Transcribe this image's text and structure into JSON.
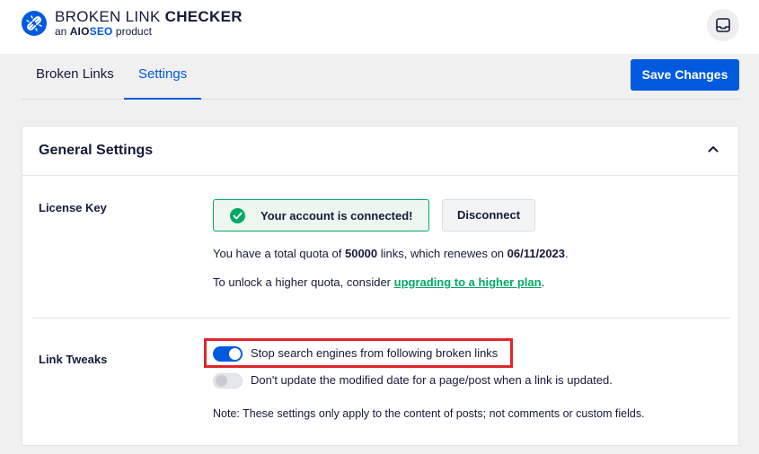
{
  "header": {
    "brand_part1": "BROKEN LINK ",
    "brand_part2": "CHECKER",
    "tagline_prefix": "an ",
    "tagline_aio": "AIO",
    "tagline_seo": "SEO",
    "tagline_suffix": " product",
    "logo_icon": "broken-link-logo-icon",
    "inbox_icon": "inbox-icon"
  },
  "tabs": [
    {
      "label": "Broken Links",
      "active": false
    },
    {
      "label": "Settings",
      "active": true
    }
  ],
  "toolbar": {
    "save_label": "Save Changes"
  },
  "general": {
    "title": "General Settings",
    "collapse_icon": "chevron-up-icon",
    "license": {
      "label": "License Key",
      "status_text": "Your account is connected!",
      "disconnect_label": "Disconnect",
      "quota_prefix": "You have a total quota of ",
      "quota_value": "50000",
      "quota_middle": " links, which renewes on ",
      "renew_date": "06/11/2023",
      "quota_suffix": ".",
      "unlock_prefix": "To unlock a higher quota, consider ",
      "unlock_link": "upgrading to a higher plan",
      "unlock_suffix": "."
    },
    "tweaks": {
      "label": "Link Tweaks",
      "options": [
        {
          "label": "Stop search engines from following broken links",
          "enabled": true
        },
        {
          "label": "Don't update the modified date for a page/post when a link is updated.",
          "enabled": false
        }
      ],
      "note": "Note: These settings only apply to the content of posts; not comments or custom fields."
    }
  },
  "colors": {
    "accent": "#005ae0",
    "success": "#00aa63",
    "highlight": "#e0262a"
  }
}
